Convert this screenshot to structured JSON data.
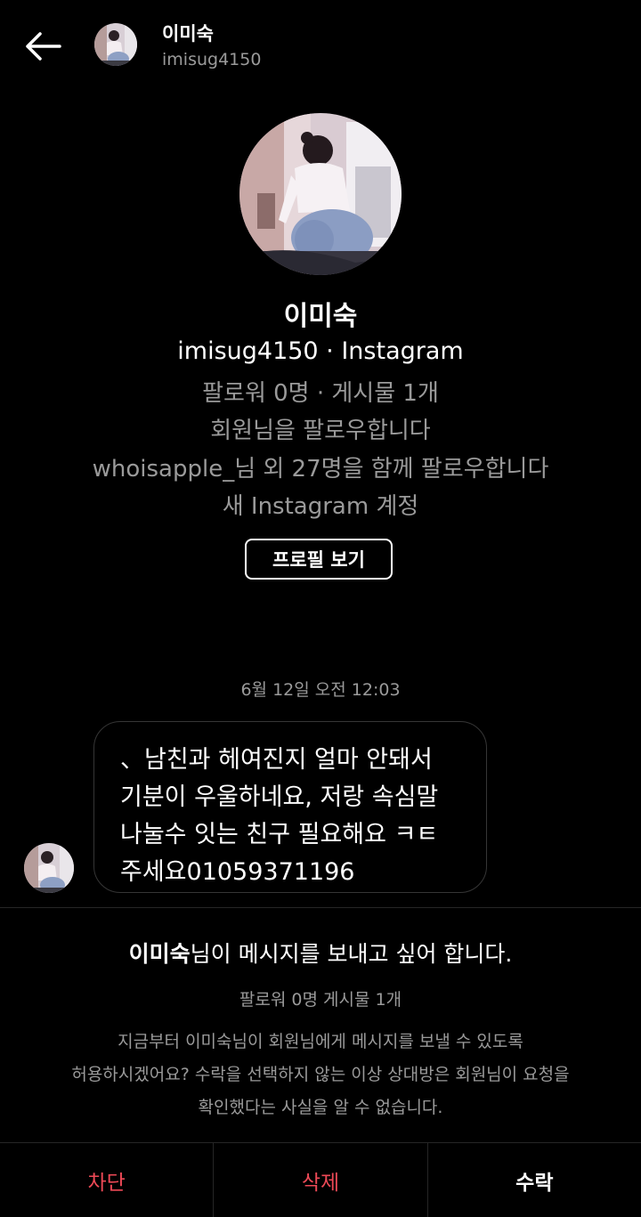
{
  "header": {
    "name": "이미숙",
    "username": "imisug4150"
  },
  "profile": {
    "name": "이미숙",
    "handle_line": "imisug4150 · Instagram",
    "stats": "팔로워 0명 · 게시물 1개",
    "follows_you": "회원님을 팔로우합니다",
    "mutual": "whoisapple_님 외 27명을 함께 팔로우합니다",
    "new_account": "새 Instagram 계정",
    "view_profile_label": "프로필 보기"
  },
  "thread": {
    "timestamp": "6월 12일 오전 12:03",
    "message_lines": [
      "、남친과 헤여진지 얼마 안돼서",
      "기분이 우울하네요, 저랑 속심말",
      "나눌수 잇는 친구 필요해요 ㅋㅌ",
      "주세요01059371196"
    ]
  },
  "request": {
    "title_name": "이미숙",
    "title_suffix": "님이 메시지를 보내고 싶어 합니다.",
    "stats": "팔로워 0명 게시물 1개",
    "description_lines": [
      "지금부터 이미숙님이 회원님에게 메시지를 보낼 수 있도록",
      "허용하시겠어요? 수락을 선택하지 않는 이상 상대방은 회원님이 요청을",
      "확인했다는 사실을 알 수 없습니다."
    ]
  },
  "actions": {
    "block": "차단",
    "delete": "삭제",
    "accept": "수락"
  },
  "icons": {
    "back": "arrow-left-icon",
    "avatar": "profile-photo"
  },
  "colors": {
    "background": "#000000",
    "secondary_text": "#9a9a9a",
    "danger": "#ed4956",
    "divider": "#262626"
  }
}
